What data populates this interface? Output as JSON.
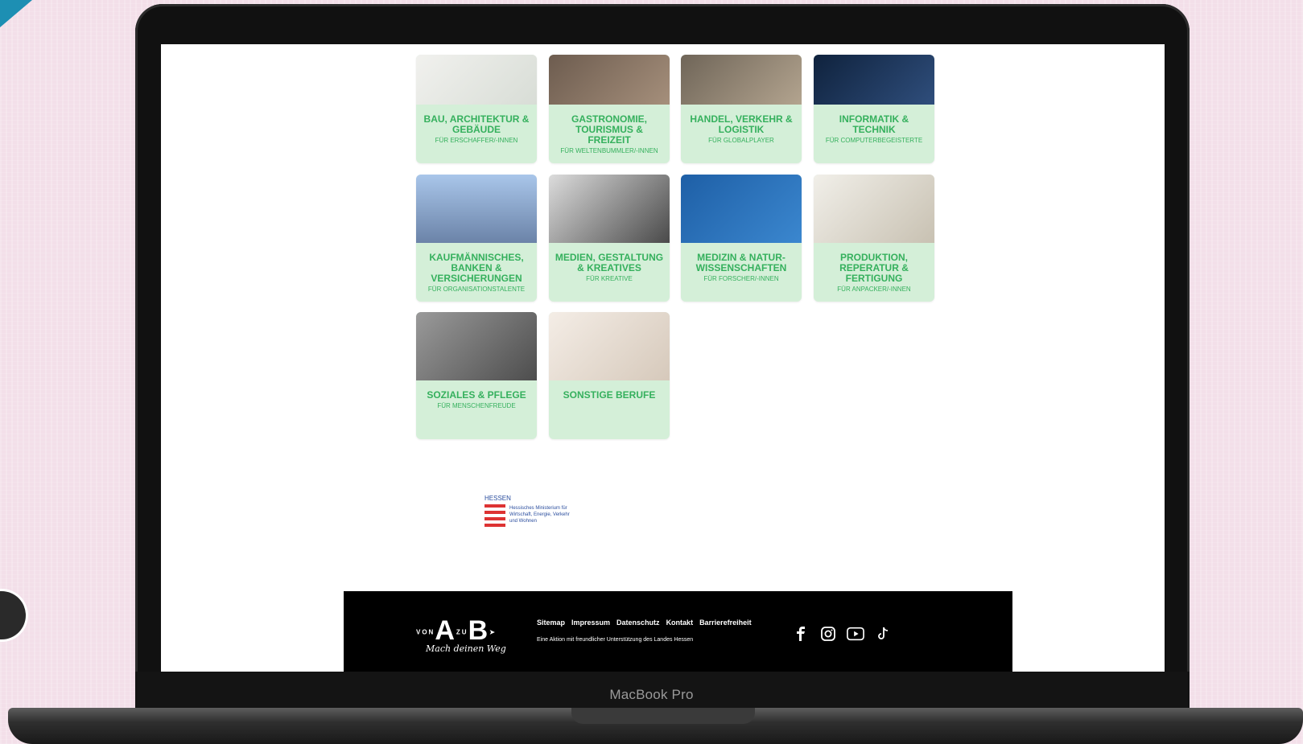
{
  "device": {
    "label": "MacBook Pro"
  },
  "tiles": [
    {
      "title": "BAU, ARCHITEKTUR & GEBÄUDE",
      "sub": "FÜR ERSCHAFFER/-INNEN",
      "img_color": "#e6e8e3"
    },
    {
      "title": "GASTRONOMIE, TOURISMUS & FREIZEIT",
      "sub": "FÜR WELTENBUMMLER/-INNEN",
      "img_color": "#7a6a5a"
    },
    {
      "title": "HANDEL, VERKEHR & LOGISTIK",
      "sub": "FÜR GLOBALPLAYER",
      "img_color": "#8b7a68"
    },
    {
      "title": "INFORMATIK & TECHNIK",
      "sub": "FÜR COMPUTERBEGEISTERTE",
      "img_color": "#1d2f4d"
    },
    {
      "title": "KAUFMÄNNISCHES, BANKEN & VERSICHERUNGEN",
      "sub": "FÜR ORGANISATIONSTALENTE",
      "img_color": "#9db7d9"
    },
    {
      "title": "MEDIEN, GESTALTUNG & KREATIVES",
      "sub": "FÜR KREATIVE",
      "img_color": "#cfcfcf"
    },
    {
      "title": "MEDIZIN & NATUR-WISSENSCHAFTEN",
      "sub": "FÜR FORSCHER/-INNEN",
      "img_color": "#2f6fb3"
    },
    {
      "title": "PRODUKTION, REPERATUR & FERTIGUNG",
      "sub": "FÜR ANPACKER/-INNEN",
      "img_color": "#e9e6e0"
    },
    {
      "title": "SOZIALES & PFLEGE",
      "sub": "FÜR MENSCHENFREUDE",
      "img_color": "#8a8a8a"
    },
    {
      "title": "SONSTIGE BERUFE",
      "sub": "",
      "img_color": "#efe7df"
    }
  ],
  "ministry": {
    "hessen": "HESSEN",
    "name": "Hessisches Ministerium für Wirtschaft, Energie, Verkehr und Wohnen"
  },
  "footer": {
    "logo_von": "VON",
    "logo_a": "A",
    "logo_zu": "ZU",
    "logo_b": "B",
    "logo_tagline": "Mach deinen Weg",
    "links": [
      "Sitemap",
      "Impressum",
      "Datenschutz",
      "Kontakt",
      "Barrierefreiheit"
    ],
    "note": "Eine Aktion mit freundlicher Unterstützung des Landes Hessen",
    "social": [
      "facebook-icon",
      "instagram-icon",
      "youtube-icon",
      "tiktok-icon"
    ]
  }
}
